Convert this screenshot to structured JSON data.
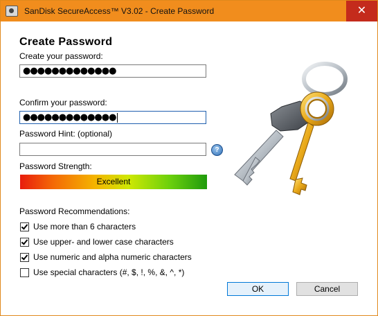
{
  "window": {
    "title": "SanDisk SecureAccess™ V3.02 - Create Password",
    "close_glyph": "✕"
  },
  "form": {
    "heading": "Create Password",
    "create_label": "Create your password:",
    "create_value": "●●●●●●●●●●●●●",
    "confirm_label": "Confirm your password:",
    "confirm_value": "●●●●●●●●●●●●●",
    "hint_label": "Password Hint: (optional)",
    "hint_value": "",
    "help_glyph": "?"
  },
  "strength": {
    "label": "Password Strength:",
    "value": "Excellent"
  },
  "recommendations": {
    "label": "Password Recommendations:",
    "items": [
      {
        "text": "Use more than 6 characters",
        "checked": true
      },
      {
        "text": "Use upper- and lower case characters",
        "checked": true
      },
      {
        "text": "Use numeric and alpha numeric characters",
        "checked": true
      },
      {
        "text": "Use special characters (#, $, !, %, &, ^, *)",
        "checked": false
      }
    ]
  },
  "buttons": {
    "ok": "OK",
    "cancel": "Cancel"
  },
  "colors": {
    "titlebar": "#f18d1d",
    "close": "#c42b1c",
    "accent": "#0078d7"
  }
}
